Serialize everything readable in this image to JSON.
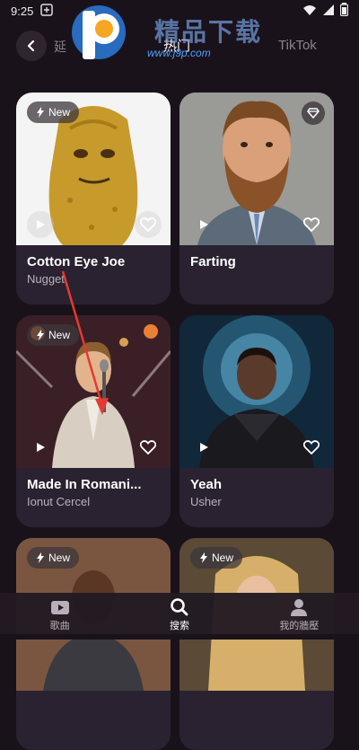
{
  "status": {
    "time": "9:25"
  },
  "header": {
    "tabs": [
      {
        "label": "延"
      },
      {
        "label": "热门"
      },
      {
        "label": "TikTok"
      }
    ]
  },
  "watermark": {
    "title": "精品下载",
    "url": "www.j9p.com"
  },
  "cards": [
    {
      "title": "Cotton Eye Joe",
      "artist": "Nugget",
      "badge": "New"
    },
    {
      "title": "Farting",
      "artist": ""
    },
    {
      "title": "Made In Romani...",
      "artist": "Ionut Cercel",
      "badge": "New"
    },
    {
      "title": "Yeah",
      "artist": "Usher"
    },
    {
      "title": "",
      "artist": "",
      "badge": "New"
    },
    {
      "title": "",
      "artist": "",
      "badge": "New"
    }
  ],
  "nav": [
    {
      "label": "歌曲",
      "icon": "video-icon"
    },
    {
      "label": "搜索",
      "icon": "search-icon"
    },
    {
      "label": "我的牆壓",
      "icon": "person-icon"
    }
  ],
  "colors": {
    "background": "#1a121b",
    "card": "#2a2230",
    "annotation_arrow": "#e53935"
  }
}
